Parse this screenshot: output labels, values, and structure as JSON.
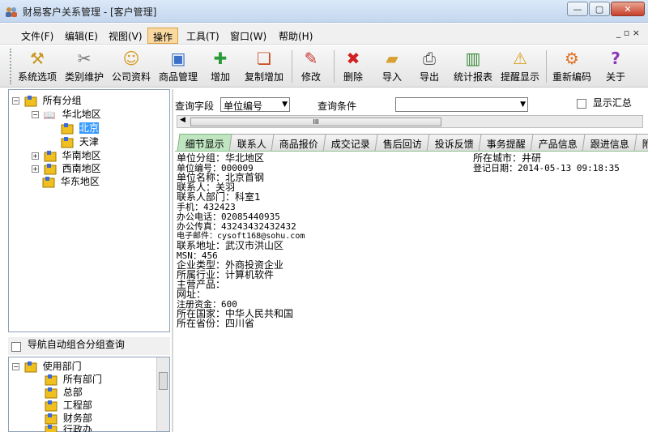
{
  "window": {
    "title": "财易客户关系管理 - [客户管理]",
    "minimize": "—",
    "restore": "▢",
    "close": "✕"
  },
  "menu": {
    "items": [
      "文件(F)",
      "编辑(E)",
      "视图(V)",
      "操作",
      "工具(T)",
      "窗口(W)",
      "帮助(H)"
    ],
    "active_index": 3,
    "mdi_controls": "_ ▫ ×"
  },
  "toolbar": {
    "buttons": [
      {
        "label": "系统选项",
        "icon": "hammer-icon"
      },
      {
        "label": "类别维护",
        "icon": "tools-icon"
      },
      {
        "label": "公司资料",
        "icon": "contact-card-icon"
      },
      {
        "label": "商品管理",
        "icon": "box-icon"
      },
      {
        "label": "增加",
        "icon": "add-user-icon"
      },
      {
        "label": "复制增加",
        "icon": "copy-add-icon"
      },
      {
        "label": "修改",
        "icon": "pencil-icon"
      },
      {
        "label": "删除",
        "icon": "delete-x-icon"
      },
      {
        "label": "导入",
        "icon": "import-folder-icon"
      },
      {
        "label": "导出",
        "icon": "export-printer-icon"
      },
      {
        "label": "统计报表",
        "icon": "bar-chart-icon"
      },
      {
        "label": "提醒显示",
        "icon": "warning-icon"
      },
      {
        "label": "重新编码",
        "icon": "recode-icon"
      },
      {
        "label": "关于",
        "icon": "help-question-icon"
      }
    ]
  },
  "group_tree": {
    "root": "所有分组",
    "nodes": [
      {
        "label": "华北地区",
        "expanded": true,
        "children": [
          "北京",
          "天津"
        ]
      },
      {
        "label": "华南地区",
        "expanded": false
      },
      {
        "label": "西南地区",
        "expanded": false
      },
      {
        "label": "华东地区",
        "expanded": false
      }
    ],
    "selected": "北京"
  },
  "auto_group_label": "导航自动组合分组查询",
  "dept_tree": {
    "root": "使用部门",
    "children": [
      "所有部门",
      "总部",
      "工程部",
      "财务部",
      "行政办"
    ]
  },
  "query": {
    "field_label": "查询字段",
    "field_value": "单位编号",
    "condition_label": "查询条件",
    "condition_value": "",
    "show_summary_label": "显示汇总",
    "show_summary_checked": false,
    "scroll_thumb": "III"
  },
  "tabs": [
    "细节显示",
    "联系人",
    "商品报价",
    "成交记录",
    "售后回访",
    "投诉反馈",
    "事务提醒",
    "产品信息",
    "跟进信息",
    "附"
  ],
  "active_tab": 0,
  "details_left": [
    "单位分组：华北地区",
    "单位编号：000009",
    "单位名称：北京首钢",
    "联系人：关羽",
    "联系人部门：科室1",
    "手机：432423",
    "办公电话：02085440935",
    "办公传真：43243432432432",
    "电子邮件：cysoft168@sohu.com",
    "联系地址：武汉市洪山区",
    "MSN：456",
    "企业类型：外商投资企业",
    "所属行业：计算机软件",
    "主营产品：",
    "网址：",
    "注册资金：600",
    "所在国家：中华人民共和国",
    "所在省份：四川省"
  ],
  "details_right": [
    "所在城市：井研",
    "登记日期：2014-05-13 09:18:35"
  ]
}
